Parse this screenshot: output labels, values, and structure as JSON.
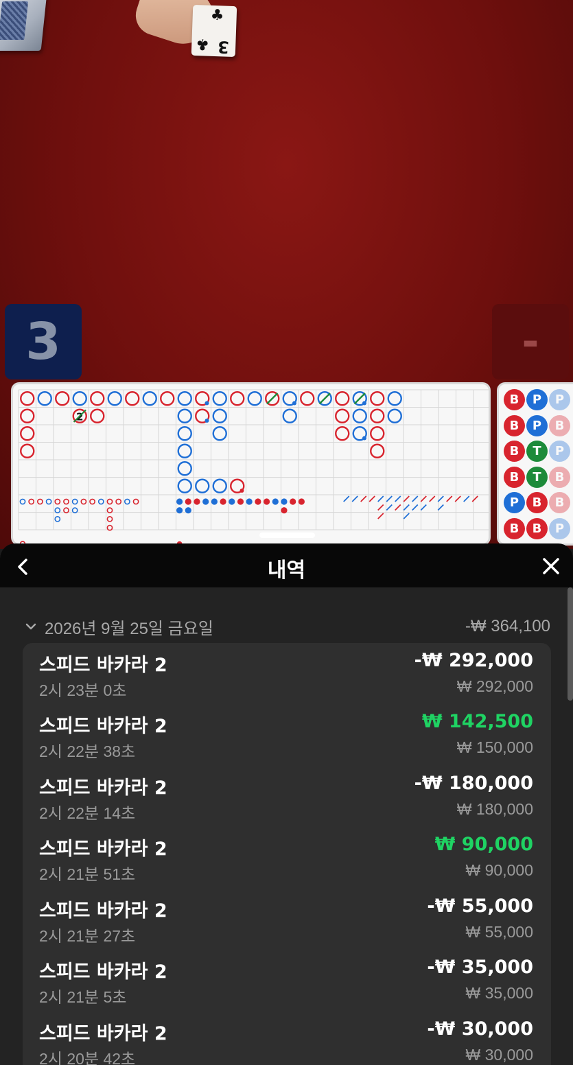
{
  "video": {
    "card_rank": "3",
    "card_suit_icon": "club-icon",
    "player_score": "3",
    "banker_score": "-"
  },
  "colors": {
    "banker": "#d8242e",
    "player": "#1f6fd6",
    "tie": "#1d8b3a",
    "win_green": "#1fd363",
    "sheet_bg": "#232323",
    "header_bg": "#080808"
  },
  "bead_road": {
    "rows": [
      [
        "B",
        "P",
        "P"
      ],
      [
        "B",
        "P",
        "B"
      ],
      [
        "B",
        "T",
        "P"
      ],
      [
        "B",
        "T",
        "B"
      ],
      [
        "P",
        "B",
        "B"
      ],
      [
        "B",
        "B",
        "P"
      ]
    ]
  },
  "big_road": {
    "tie_count_label": "2"
  },
  "sheet": {
    "title": "내역",
    "back_icon": "chevron-left-icon",
    "close_icon": "close-icon",
    "date_label": "2026년 9월 25일 금요일",
    "date_total": "-₩ 364,100",
    "entries": [
      {
        "game": "스피드 바카라 2",
        "time": "2시 23분 0초",
        "result": "-₩ 292,000",
        "stake": "₩ 292,000",
        "win": false
      },
      {
        "game": "스피드 바카라 2",
        "time": "2시 22분 38초",
        "result": "₩ 142,500",
        "stake": "₩ 150,000",
        "win": true
      },
      {
        "game": "스피드 바카라 2",
        "time": "2시 22분 14초",
        "result": "-₩ 180,000",
        "stake": "₩ 180,000",
        "win": false
      },
      {
        "game": "스피드 바카라 2",
        "time": "2시 21분 51초",
        "result": "₩ 90,000",
        "stake": "₩ 90,000",
        "win": true
      },
      {
        "game": "스피드 바카라 2",
        "time": "2시 21분 27초",
        "result": "-₩ 55,000",
        "stake": "₩ 55,000",
        "win": false
      },
      {
        "game": "스피드 바카라 2",
        "time": "2시 21분 5초",
        "result": "-₩ 35,000",
        "stake": "₩ 35,000",
        "win": false
      },
      {
        "game": "스피드 바카라 2",
        "time": "2시 20분 42초",
        "result": "-₩ 30,000",
        "stake": "₩ 30,000",
        "win": false
      }
    ]
  }
}
